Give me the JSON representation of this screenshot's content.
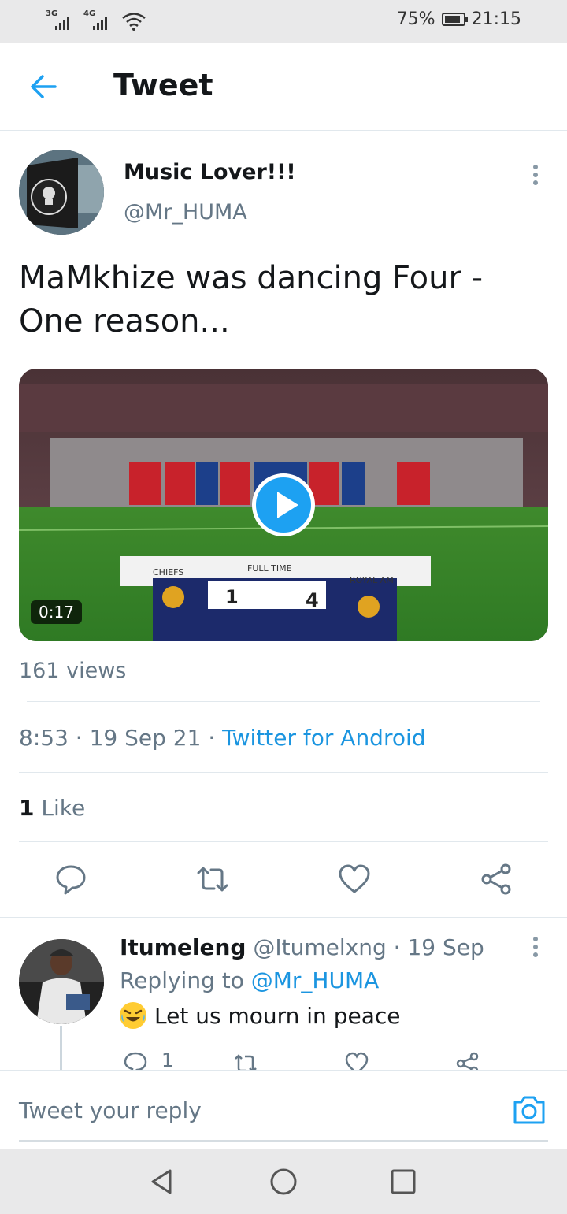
{
  "status_bar": {
    "signal1_label": "3G",
    "signal2_label": "4G",
    "battery": "75%",
    "time": "21:15"
  },
  "header": {
    "title": "Tweet"
  },
  "tweet": {
    "author_name": "Music Lover!!!",
    "author_handle": "@Mr_HUMA",
    "text": "MaMkhize was dancing Four - One reason...",
    "media": {
      "duration": "0:17",
      "score_left_team": "CHIEFS",
      "score_right_team": "ROYAL AM",
      "score_label": "FULL TIME",
      "score_left": "1",
      "score_right": "4"
    },
    "views": "161 views",
    "time": "8:53",
    "date": "19 Sep 21",
    "source": "Twitter for Android",
    "like_count": "1",
    "like_label": "Like"
  },
  "reply": {
    "name": "Itumeleng",
    "handle": "@Itumelxng",
    "date": "19 Sep",
    "replying_prefix": "Replying to",
    "replying_to": "@Mr_HUMA",
    "text": "Let us mourn in peace",
    "reply_count": "1"
  },
  "compose": {
    "placeholder": "Tweet your reply"
  },
  "colors": {
    "accent": "#1da1f2",
    "link": "#1b95e0",
    "muted": "#657786"
  }
}
